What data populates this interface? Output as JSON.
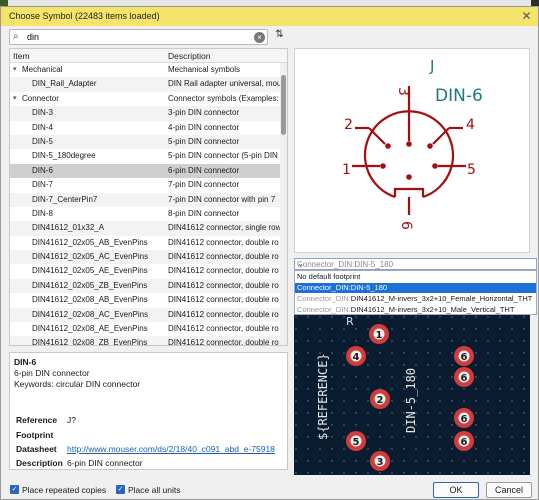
{
  "window": {
    "title": "Choose Symbol (22483 items loaded)"
  },
  "search": {
    "value": "din"
  },
  "tree": {
    "headers": {
      "item": "Item",
      "description": "Description"
    },
    "rows": [
      {
        "item": "Mechanical",
        "description": "Mechanical symbols",
        "group": true
      },
      {
        "item": "DIN_Rail_Adapter",
        "description": "DIN Rail adapter universal, mou"
      },
      {
        "item": "Connector",
        "description": "Connector symbols (Examples: ",
        "group": true
      },
      {
        "item": "DIN-3",
        "description": "3-pin DIN connector"
      },
      {
        "item": "DIN-4",
        "description": "4-pin DIN connector"
      },
      {
        "item": "DIN-5",
        "description": "5-pin DIN connector"
      },
      {
        "item": "DIN-5_180degree",
        "description": "5-pin DIN connector (5-pin DIN"
      },
      {
        "item": "DIN-6",
        "description": "6-pin DIN connector",
        "selected": true
      },
      {
        "item": "DIN-7",
        "description": "7-pin DIN connector"
      },
      {
        "item": "DIN-7_CenterPin7",
        "description": "7-pin DIN connector with pin 7"
      },
      {
        "item": "DIN-8",
        "description": "8-pin DIN connector"
      },
      {
        "item": "DIN41612_01x32_A",
        "description": "DIN41612 connector, single row"
      },
      {
        "item": "DIN41612_02x05_AB_EvenPins",
        "description": "DIN41612 connector, double ro"
      },
      {
        "item": "DIN41612_02x05_AC_EvenPins",
        "description": "DIN41612 connector, double ro"
      },
      {
        "item": "DIN41612_02x05_AE_EvenPins",
        "description": "DIN41612 connector, double ro"
      },
      {
        "item": "DIN41612_02x05_ZB_EvenPins",
        "description": "DIN41612 connector, double ro"
      },
      {
        "item": "DIN41612_02x08_AB_EvenPins",
        "description": "DIN41612 connector, double ro"
      },
      {
        "item": "DIN41612_02x08_AC_EvenPins",
        "description": "DIN41612 connector, double ro"
      },
      {
        "item": "DIN41612_02x08_AE_EvenPins",
        "description": "DIN41612 connector, double ro"
      },
      {
        "item": "DIN41612_02x08_ZB_EvenPins",
        "description": "DIN41612 connector, double ro"
      }
    ]
  },
  "info": {
    "name": "DIN-6",
    "description": "6-pin DIN connector",
    "keywords": "Keywords: circular DIN connector",
    "fields": [
      {
        "label": "Reference",
        "value": "J?"
      },
      {
        "label": "Footprint",
        "value": ""
      },
      {
        "label": "Datasheet",
        "value": "http://www.mouser.com/ds/2/18/40_c091_abd_e-75918",
        "link": true
      },
      {
        "label": "Description",
        "value": "6-pin DIN connector"
      }
    ]
  },
  "symbol": {
    "reference": "J",
    "value": "DIN-6",
    "pins": [
      "1",
      "2",
      "3",
      "4",
      "5",
      "6"
    ],
    "color": "#a50f0f"
  },
  "footprint_select": {
    "value": "Connector_DIN:DIN-5_180",
    "options": [
      {
        "label": "No default footprint",
        "dim": false,
        "selected": false
      },
      {
        "label": "Connector_DIN:DIN-5_180",
        "dim": false,
        "selected": true
      },
      {
        "prefix": "Connector_DIN:",
        "label": "DIN41612_M-invers_3x2+10_Female_Horizontal_THT",
        "dim": true
      },
      {
        "prefix": "Connector_DIN:",
        "label": "DIN41612_M-invers_3x2+10_Male_Vertical_THT",
        "dim": true
      }
    ]
  },
  "footprint_preview": {
    "reference_label": "${REFERENCE}",
    "value_label": "DIN-5_180",
    "ref_letter": "R",
    "pads": [
      "1",
      "4",
      "6",
      "6",
      "2",
      "6",
      "5",
      "6",
      "3"
    ],
    "pad_color": "#d23c3c",
    "bg_color": "#0a1d30"
  },
  "bottom": {
    "place_repeated": "Place repeated copies",
    "place_all_units": "Place all units",
    "ok": "OK",
    "cancel": "Cancel"
  }
}
